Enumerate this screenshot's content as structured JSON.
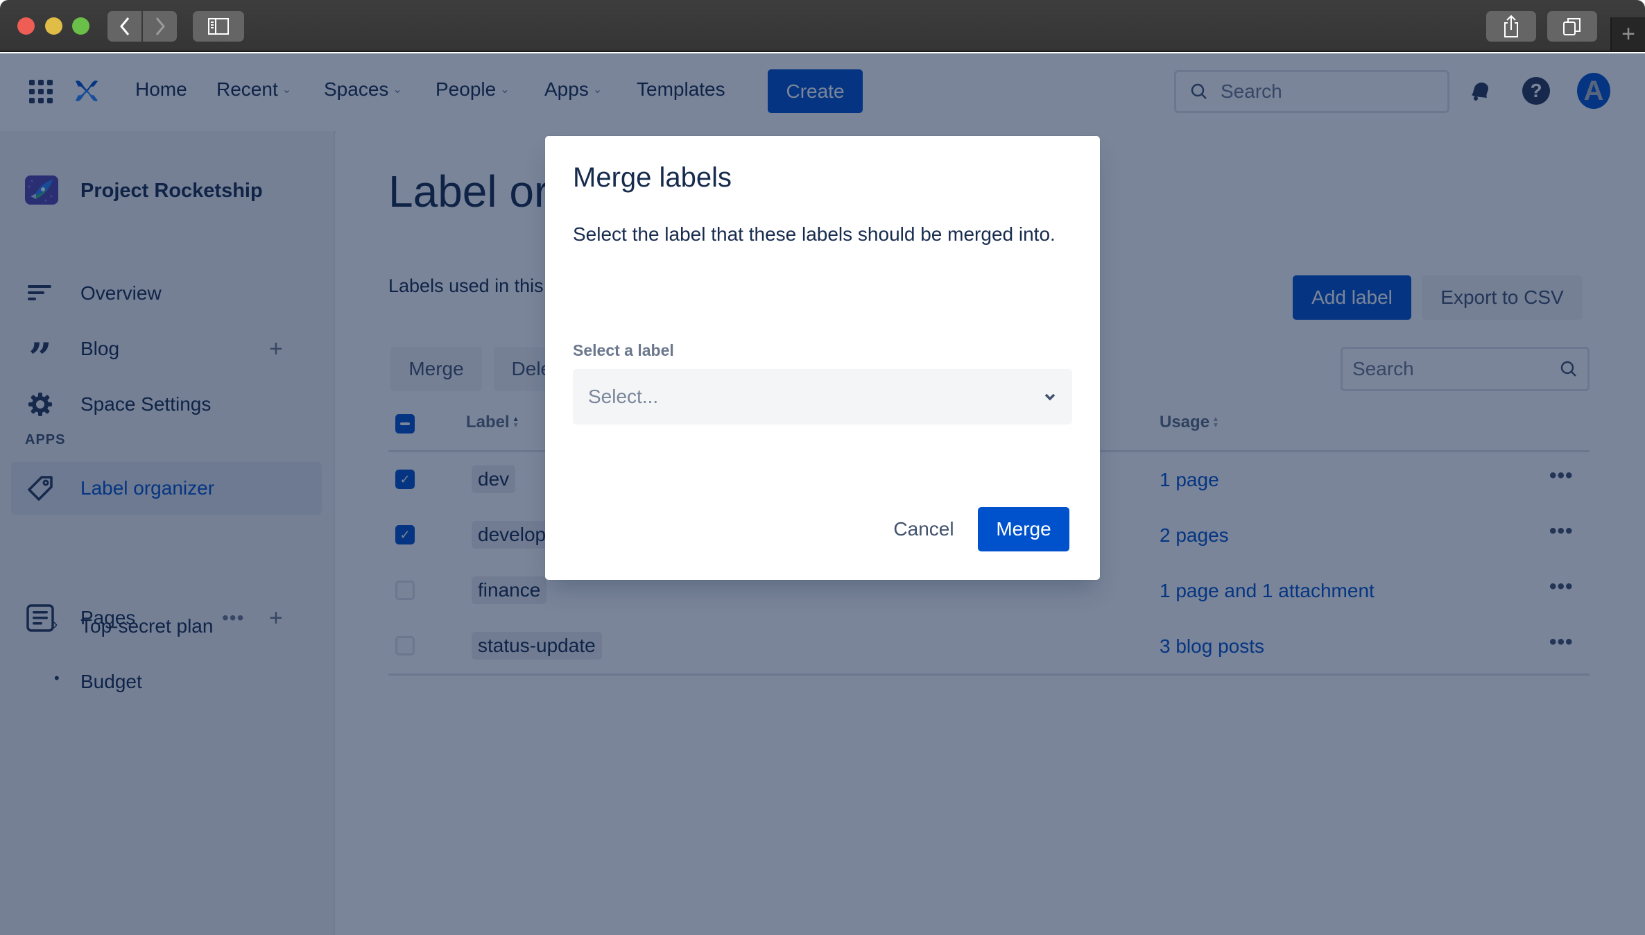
{
  "browser": {
    "back_label": "Back",
    "forward_label": "Forward",
    "new_tab_symbol": "+"
  },
  "topnav": {
    "items": [
      {
        "label": "Home",
        "has_dropdown": false
      },
      {
        "label": "Recent",
        "has_dropdown": true
      },
      {
        "label": "Spaces",
        "has_dropdown": true
      },
      {
        "label": "People",
        "has_dropdown": true
      },
      {
        "label": "Apps",
        "has_dropdown": true
      },
      {
        "label": "Templates",
        "has_dropdown": false
      }
    ],
    "create_label": "Create",
    "search_placeholder": "Search",
    "avatar_initial": "A",
    "help_glyph": "?"
  },
  "sidebar": {
    "space_name": "Project Rocketship",
    "items": [
      {
        "label": "Overview",
        "icon": "overview-icon"
      },
      {
        "label": "Blog",
        "icon": "quote-icon"
      },
      {
        "label": "Space Settings",
        "icon": "gear-icon"
      }
    ],
    "apps_heading": "APPS",
    "apps_items": [
      {
        "label": "Label organizer",
        "icon": "tag-icon",
        "active": true
      }
    ],
    "pages_label": "Pages",
    "pages_more": "•••",
    "add_symbol": "+",
    "tree": [
      {
        "label": "Top-secret plan",
        "marker": "chevron-right"
      },
      {
        "label": "Budget",
        "marker": "bullet"
      }
    ]
  },
  "main": {
    "title": "Label organizer",
    "description": "Labels used in this space",
    "add_label": "Add label",
    "export_csv": "Export to CSV",
    "merge_label": "Merge",
    "delete_label": "Delete",
    "search_placeholder": "Search",
    "columns": {
      "label": "Label",
      "usage": "Usage"
    },
    "rows": [
      {
        "label": "dev",
        "usage": "1 page",
        "checked": true
      },
      {
        "label": "development",
        "usage": "2 pages",
        "checked": true
      },
      {
        "label": "finance",
        "usage": "1 page and 1 attachment",
        "checked": false
      },
      {
        "label": "status-update",
        "usage": "3 blog posts",
        "checked": false
      }
    ],
    "row_more": "•••"
  },
  "modal": {
    "title": "Merge labels",
    "body": "Select the label that these labels should be merged into.",
    "field_label": "Select a label",
    "select_placeholder": "Select...",
    "cancel_label": "Cancel",
    "merge_label": "Merge"
  },
  "colors": {
    "brand_blue": "#0052cc",
    "text_dark": "#172b4d",
    "overlay": "rgba(9,30,66,0.54)"
  }
}
